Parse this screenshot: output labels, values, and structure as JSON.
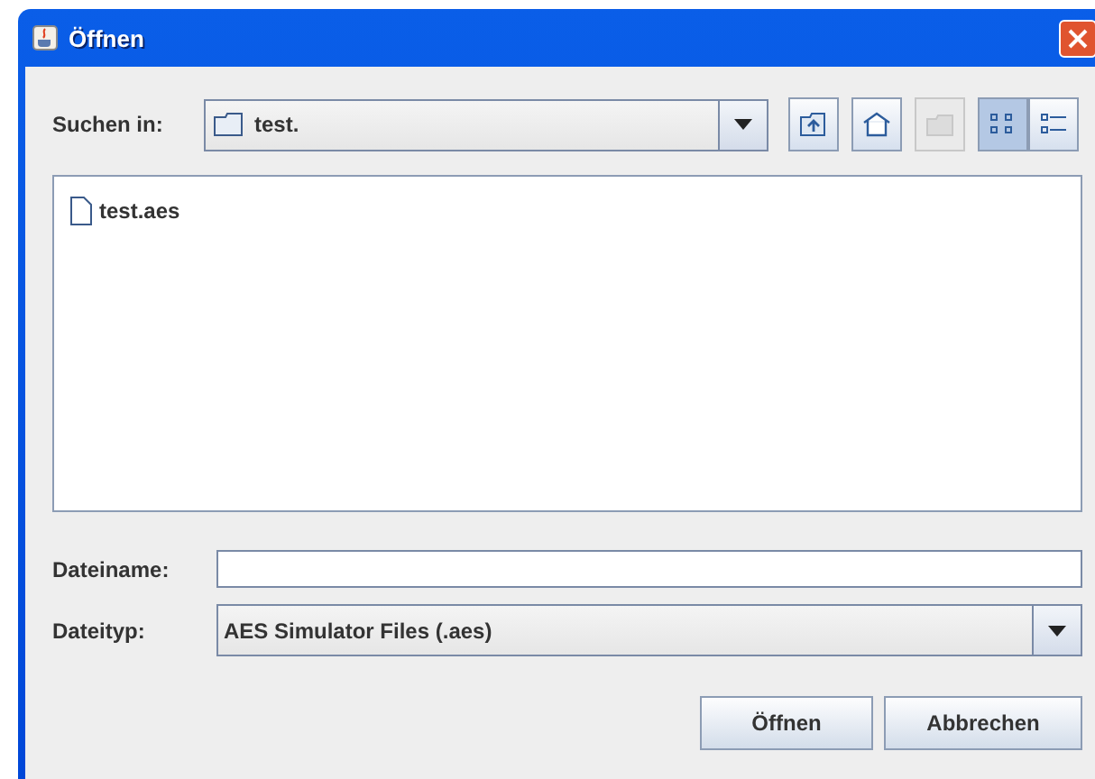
{
  "window": {
    "title": "Öffnen"
  },
  "look_in": {
    "label": "Suchen in:",
    "value": "test."
  },
  "toolbar": [
    {
      "kind": "up",
      "disabled": false,
      "selected": false
    },
    {
      "kind": "home",
      "disabled": false,
      "selected": false
    },
    {
      "kind": "newfolder",
      "disabled": true,
      "selected": false
    },
    {
      "kind": "list",
      "disabled": false,
      "selected": true
    },
    {
      "kind": "details",
      "disabled": false,
      "selected": false
    }
  ],
  "files": [
    {
      "name": "test.aes",
      "selected": false
    }
  ],
  "file_name": {
    "label": "Dateiname:"
  },
  "file_type": {
    "label": "Dateityp:",
    "value": "AES Simulator Files (.aes)"
  },
  "buttons": [
    "Öffnen",
    "Abbrechen"
  ]
}
